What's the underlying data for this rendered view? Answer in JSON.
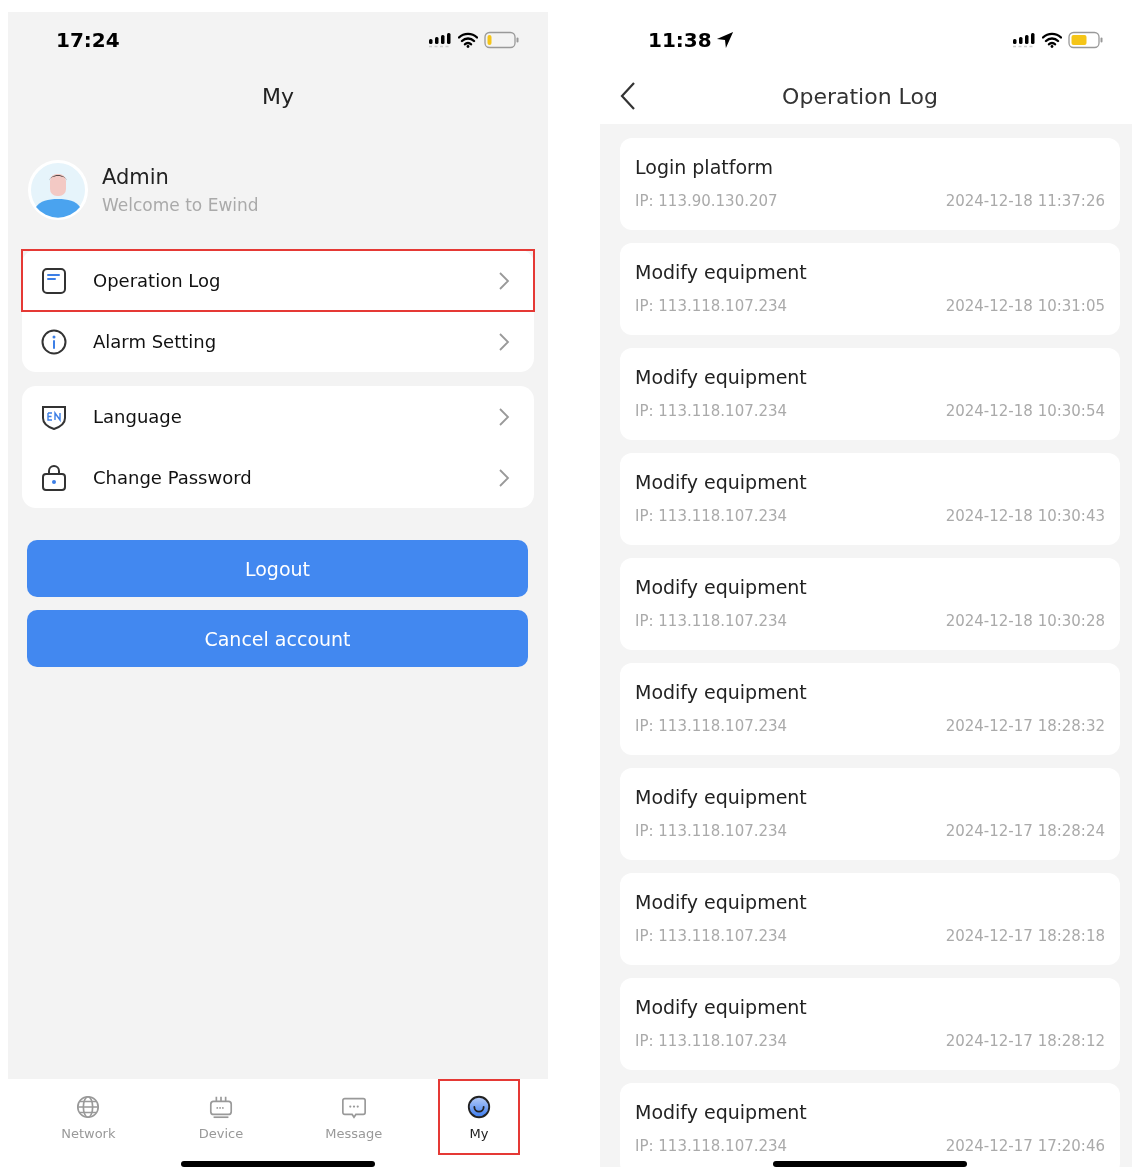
{
  "my_screen": {
    "status_bar": {
      "time": "17:24"
    },
    "title": "My",
    "profile": {
      "name": "Admin",
      "subtitle": "Welcome to Ewind"
    },
    "menu_groups": [
      {
        "items": [
          {
            "kind": "log",
            "label": "Operation Log",
            "highlighted": true
          },
          {
            "kind": "info",
            "label": "Alarm Setting",
            "highlighted": false
          }
        ]
      },
      {
        "items": [
          {
            "kind": "language",
            "label": "Language",
            "highlighted": false
          },
          {
            "kind": "lock",
            "label": "Change Password",
            "highlighted": false
          }
        ]
      }
    ],
    "buttons": [
      "Logout",
      "Cancel account"
    ],
    "tabs": [
      {
        "kind": "globe",
        "label": "Network",
        "selected": false,
        "highlighted": false
      },
      {
        "kind": "device",
        "label": "Device",
        "selected": false,
        "highlighted": false
      },
      {
        "kind": "message",
        "label": "Message",
        "selected": false,
        "highlighted": false
      },
      {
        "kind": "face",
        "label": "My",
        "selected": true,
        "highlighted": true
      }
    ]
  },
  "log_screen": {
    "status_bar": {
      "time": "11:38"
    },
    "title": "Operation Log",
    "entries": [
      {
        "action": "Login platform",
        "ip": "IP: 113.90.130.207",
        "time": "2024-12-18 11:37:26"
      },
      {
        "action": "Modify equipment",
        "ip": "IP: 113.118.107.234",
        "time": "2024-12-18 10:31:05"
      },
      {
        "action": "Modify equipment",
        "ip": "IP: 113.118.107.234",
        "time": "2024-12-18 10:30:54"
      },
      {
        "action": "Modify equipment",
        "ip": "IP: 113.118.107.234",
        "time": "2024-12-18 10:30:43"
      },
      {
        "action": "Modify equipment",
        "ip": "IP: 113.118.107.234",
        "time": "2024-12-18 10:30:28"
      },
      {
        "action": "Modify equipment",
        "ip": "IP: 113.118.107.234",
        "time": "2024-12-17 18:28:32"
      },
      {
        "action": "Modify equipment",
        "ip": "IP: 113.118.107.234",
        "time": "2024-12-17 18:28:24"
      },
      {
        "action": "Modify equipment",
        "ip": "IP: 113.118.107.234",
        "time": "2024-12-17 18:28:18"
      },
      {
        "action": "Modify equipment",
        "ip": "IP: 113.118.107.234",
        "time": "2024-12-17 18:28:12"
      },
      {
        "action": "Modify equipment",
        "ip": "IP: 113.118.107.234",
        "time": "2024-12-17 17:20:46"
      }
    ]
  }
}
